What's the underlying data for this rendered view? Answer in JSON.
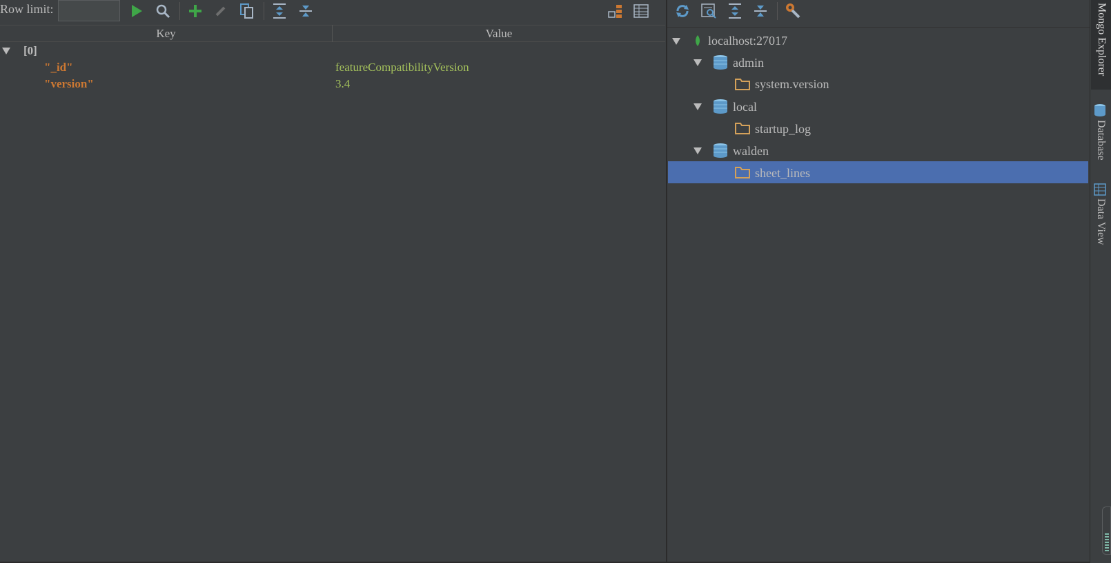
{
  "toolbar": {
    "row_limit_label": "Row limit:",
    "row_limit_value": "",
    "icons": [
      "run-icon",
      "find-icon",
      "add-icon",
      "edit-icon",
      "copy-icon",
      "expand-all-icon",
      "collapse-all-icon",
      "tree-view-icon",
      "table-view-icon"
    ]
  },
  "table": {
    "columns": [
      "Key",
      "Value"
    ],
    "root_label": "[0]",
    "rows": [
      {
        "key": "\"_id\"",
        "value": "featureCompatibilityVersion"
      },
      {
        "key": "\"version\"",
        "value": "3.4"
      }
    ]
  },
  "explorer": {
    "toolbar_icons": [
      "refresh-icon",
      "query-icon",
      "expand-all-icon",
      "collapse-all-icon",
      "settings-icon"
    ],
    "server": "localhost:27017",
    "databases": [
      {
        "name": "admin",
        "collections": [
          "system.version"
        ]
      },
      {
        "name": "local",
        "collections": [
          "startup_log"
        ]
      },
      {
        "name": "walden",
        "collections": [
          "sheet_lines"
        ]
      }
    ],
    "selected": "sheet_lines"
  },
  "side_tabs": {
    "mongo_explorer": "Mongo Explorer",
    "database": "Database",
    "data_view": "Data View"
  },
  "colors": {
    "background": "#3c3f41",
    "key": "#cc7832",
    "value": "#a5c25c",
    "selection": "#4b6eaf",
    "run_green": "#3fa648",
    "icon_blue": "#5d9ac9"
  }
}
